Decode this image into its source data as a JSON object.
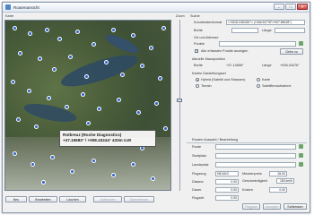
{
  "window": {
    "title": "Routenansicht"
  },
  "map": {
    "label": "Karte",
    "tooltip": {
      "name": "Rotkreuz (Roche Diagnostics)",
      "coords": "+47.15683° / +008.43244° 433m ü.M"
    }
  },
  "zoom": {
    "label": "Zoom"
  },
  "search": {
    "heading": "Suche",
    "coord_format_label": "Koordinatenformat",
    "coord_format_value": "<+DDD.DDDDD°> (+046.54778°/+007.89028°)",
    "lat_label": "Breite",
    "lat_value": "",
    "lon_label": "Länge",
    "lon_value": "",
    "place_label": "Ort und Adresse",
    "points_label": "Punkte",
    "points_value": "",
    "show_all_label": "Alle erfassten Punkte anzeigen",
    "goto_button": "Gehe zu"
  },
  "mouse_pos": {
    "heading": "Aktuelle Mausposition",
    "lat_label": "Breite",
    "lat_value": "+47.14656°",
    "lon_label": "Länge",
    "lon_value": "+008.43476°"
  },
  "map_display": {
    "heading": "Karten Darstellungsart",
    "options": [
      "Hybrid (Satellit und Strassen)",
      "Karte",
      "Terrain",
      "Satellitenaufnahme"
    ]
  },
  "route": {
    "heading": "Routen Auswahl / Bearbeitung",
    "route_label": "Route",
    "route_value": "",
    "start_label": "Startplatz",
    "start_value": "",
    "landing_label": "Landeplatz",
    "landing_value": "",
    "flight_label": "Flugzeug",
    "flight_value": "HB-KKG",
    "minutes_label": "Minutenpreis",
    "minutes_value": "26.00",
    "speed_label": "Geschwindigkeit",
    "speed_value": "180 km/h",
    "distance_label": "Distanz",
    "distance_value": "0.00",
    "duration_label": "Dauer",
    "duration_value": "0.00",
    "flight_time_label": "Flugzeit",
    "flight_time_value": "0.00",
    "cost_label": "Kosten",
    "cost_value": "0.00",
    "btn_right1": "Flugplan",
    "btn_right2": "Anzeigen",
    "btn_close": "Schliessen"
  },
  "footer_buttons": {
    "new": "Neu",
    "edit": "Bearbeiten",
    "delete": "Löschen",
    "cancel": "Abbrechen",
    "accept": "Übernehmen"
  },
  "colors": {
    "accent": "#2a62c9",
    "window_bg": "#f0f0f0"
  }
}
